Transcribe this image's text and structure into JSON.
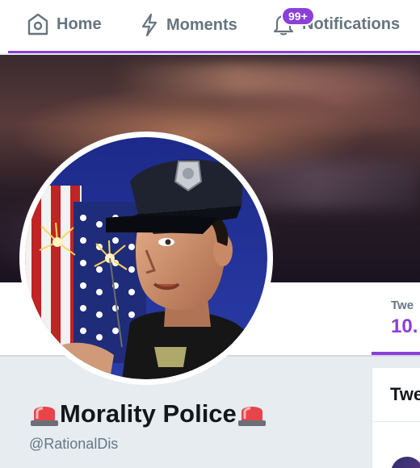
{
  "nav": {
    "home_label": "Home",
    "moments_label": "Moments",
    "notifications_label": "Notifications",
    "notifications_badge": "99+",
    "home_icon": "home-icon",
    "moments_icon": "lightning-icon",
    "notifications_icon": "bell-icon"
  },
  "profile": {
    "display_name": "Morality Police",
    "handle": "@RationalDis",
    "name_emoji": "police-siren"
  },
  "stats": {
    "tweets_label": "Twe",
    "tweets_value": "10."
  },
  "tweets_panel": {
    "title": "Twe"
  },
  "colors": {
    "accent": "#8b3fd9",
    "nav_text": "#66757f",
    "background": "#e6ecf0",
    "handle_text": "#657786"
  }
}
